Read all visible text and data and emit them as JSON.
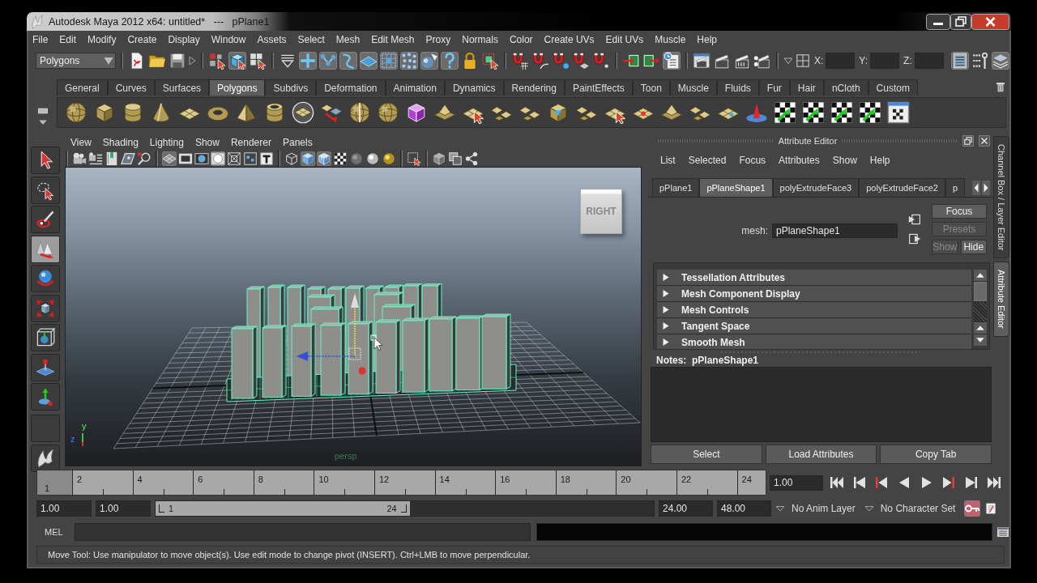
{
  "window": {
    "title": "Autodesk Maya 2012 x64: untitled*   ---   pPlane1"
  },
  "menu_bar": [
    "File",
    "Edit",
    "Modify",
    "Create",
    "Display",
    "Window",
    "Assets",
    "Select",
    "Mesh",
    "Edit Mesh",
    "Proxy",
    "Normals",
    "Color",
    "Create UVs",
    "Edit UVs",
    "Muscle",
    "Help"
  ],
  "status_line": {
    "menu_set": "Polygons",
    "tools": [
      {
        "on": false
      },
      {
        "on": false
      },
      {
        "on": false
      },
      {
        "on": false
      },
      {
        "on": true
      },
      {
        "on": false
      },
      {
        "on": false
      },
      {
        "on": true
      },
      {
        "on": true
      },
      {
        "on": true
      },
      {
        "on": true
      },
      {
        "on": true
      },
      {
        "on": true
      },
      {
        "on": true
      },
      {
        "on": true
      },
      {
        "on": false
      },
      {
        "on": false
      },
      {
        "on": false
      },
      {
        "on": false
      },
      {
        "on": false
      },
      {
        "on": false
      },
      {
        "on": false
      },
      {
        "on": false
      },
      {
        "on": false
      },
      {
        "on": true
      },
      {
        "on": false
      },
      {
        "on": false
      },
      {
        "on": false
      },
      {
        "on": false
      }
    ],
    "coordinate_labels": [
      "X:",
      "Y:",
      "Z:"
    ],
    "panel_toggles": [
      {
        "on": true
      },
      {
        "on": false
      },
      {
        "on": true
      }
    ]
  },
  "shelf": {
    "tabs": [
      {
        "label": "General",
        "selected": false
      },
      {
        "label": "Curves",
        "selected": false
      },
      {
        "label": "Surfaces",
        "selected": false
      },
      {
        "label": "Polygons",
        "selected": true
      },
      {
        "label": "Subdivs",
        "selected": false
      },
      {
        "label": "Deformation",
        "selected": false
      },
      {
        "label": "Animation",
        "selected": false
      },
      {
        "label": "Dynamics",
        "selected": false
      },
      {
        "label": "Rendering",
        "selected": false
      },
      {
        "label": "PaintEffects",
        "selected": false
      },
      {
        "label": "Toon",
        "selected": false
      },
      {
        "label": "Muscle",
        "selected": false
      },
      {
        "label": "Fluids",
        "selected": false
      },
      {
        "label": "Fur",
        "selected": false
      },
      {
        "label": "Hair",
        "selected": false
      },
      {
        "label": "nCloth",
        "selected": false
      },
      {
        "label": "Custom",
        "selected": false
      }
    ]
  },
  "toolbox": [
    {
      "selected": false
    },
    {
      "selected": false
    },
    {
      "selected": false
    },
    {
      "selected": true
    },
    {
      "selected": false
    },
    {
      "selected": false
    },
    {
      "selected": false
    },
    {
      "selected": false
    },
    {
      "selected": false
    }
  ],
  "viewport": {
    "menus": [
      "View",
      "Shading",
      "Lighting",
      "Show",
      "Renderer",
      "Panels"
    ],
    "tools": [
      {
        "on": false
      },
      {
        "on": false
      },
      {
        "on": false
      },
      {
        "on": false
      },
      {
        "on": false
      },
      {
        "on": true
      },
      {
        "on": false
      },
      {
        "on": false
      },
      {
        "on": true
      },
      {
        "on": false
      },
      {
        "on": false
      },
      {
        "on": false
      },
      {
        "on": false
      },
      {
        "on": true
      },
      {
        "on": true
      },
      {
        "on": false
      },
      {
        "on": false
      },
      {
        "on": false
      },
      {
        "on": false
      },
      {
        "on": false
      },
      {
        "on": false
      },
      {
        "on": false
      },
      {
        "on": false
      }
    ],
    "view_cube": "RIGHT",
    "axis_labels": [
      "y",
      "z"
    ],
    "camera": "persp"
  },
  "attribute_editor": {
    "title": "Attribute Editor",
    "menus": [
      "List",
      "Selected",
      "Focus",
      "Attributes",
      "Show",
      "Help"
    ],
    "tabs": [
      {
        "label": "pPlane1",
        "selected": false
      },
      {
        "label": "pPlaneShape1",
        "selected": true
      },
      {
        "label": "polyExtrudeFace3",
        "selected": false
      },
      {
        "label": "polyExtrudeFace2",
        "selected": false
      },
      {
        "label": "p",
        "selected": false
      }
    ],
    "mesh_label": "mesh:",
    "mesh_name": "pPlaneShape1",
    "buttons": [
      {
        "label": "Focus",
        "disabled": false
      },
      {
        "label": "Presets",
        "disabled": true
      },
      {
        "label": "Show",
        "disabled": true
      },
      {
        "label": "Hide",
        "disabled": false
      }
    ],
    "sections": [
      {
        "label": "Tessellation Attributes",
        "expanded": false
      },
      {
        "label": "Mesh Component Display",
        "expanded": false
      },
      {
        "label": "Mesh Controls",
        "expanded": false
      },
      {
        "label": "Tangent Space",
        "expanded": false
      },
      {
        "label": "Smooth Mesh",
        "expanded": false
      }
    ],
    "notes_title": "Notes:  pPlaneShape1",
    "actions": [
      "Select",
      "Load Attributes",
      "Copy Tab"
    ]
  },
  "side_tabs": [
    {
      "label": "Channel Box / Layer Editor",
      "selected": false
    },
    {
      "label": "Attribute Editor",
      "selected": true
    }
  ],
  "time_slider": {
    "ticks": [
      "2",
      "4",
      "6",
      "8",
      "10",
      "12",
      "14",
      "16",
      "18",
      "20",
      "22",
      "24"
    ],
    "current_frame": "1",
    "level": 0,
    "current_time": "1.00"
  },
  "range_slider": {
    "start_time": "1.00",
    "playback_start": "1.00",
    "range_start": "1",
    "range_end": "24",
    "level": 0.51,
    "playback_end": "24.00",
    "end_time": "48.00",
    "anim_layer": "No Anim Layer",
    "character_set": "No Character Set",
    "auto_key": true
  },
  "command_line": {
    "language": "MEL"
  },
  "help_line": "Move Tool: Use manipulator to move object(s). Use edit mode to change pivot (INSERT).  Ctrl+LMB to move perpendicular."
}
